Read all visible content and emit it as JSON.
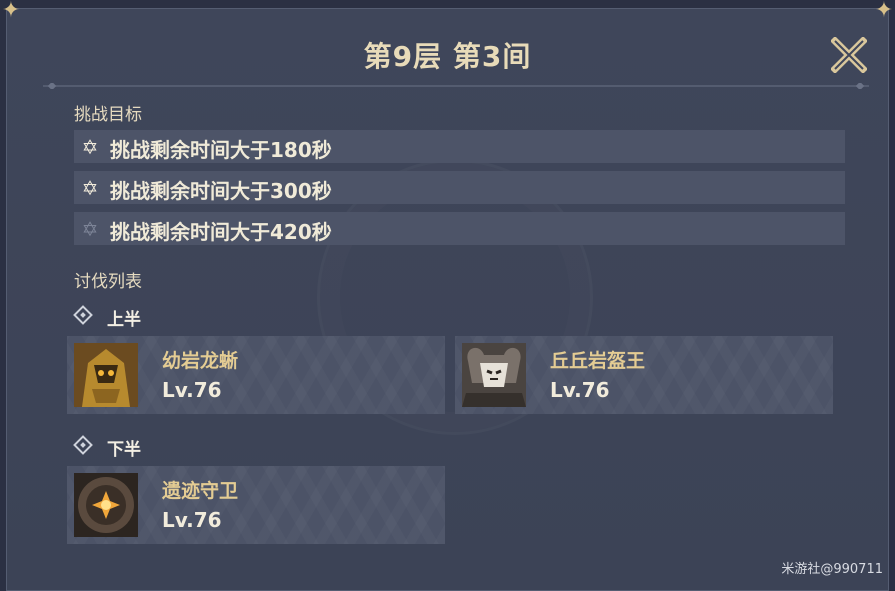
{
  "header": {
    "title": "第9层 第3间"
  },
  "goals": {
    "label": "挑战目标",
    "items": [
      {
        "text": "挑战剩余时间大于180秒",
        "achieved": true
      },
      {
        "text": "挑战剩余时间大于300秒",
        "achieved": true
      },
      {
        "text": "挑战剩余时间大于420秒",
        "achieved": false
      }
    ]
  },
  "enemies": {
    "label": "讨伐列表",
    "first_half": {
      "label": "上半",
      "items": [
        {
          "name": "幼岩龙蜥",
          "level": "Lv.76"
        },
        {
          "name": "丘丘岩盔王",
          "level": "Lv.76"
        }
      ]
    },
    "second_half": {
      "label": "下半",
      "items": [
        {
          "name": "遗迹守卫",
          "level": "Lv.76"
        }
      ]
    }
  },
  "footer": {
    "credit": "米游社@990711"
  },
  "colors": {
    "panel": "#3f465a",
    "row": "#4d5468",
    "gold": "#e4cc93",
    "title": "#e8dbb9"
  },
  "icons": [
    "star-icon",
    "close-icon",
    "diamond-icon",
    "lizard-portrait-icon",
    "lawachurl-portrait-icon",
    "ruin-guard-portrait-icon"
  ]
}
